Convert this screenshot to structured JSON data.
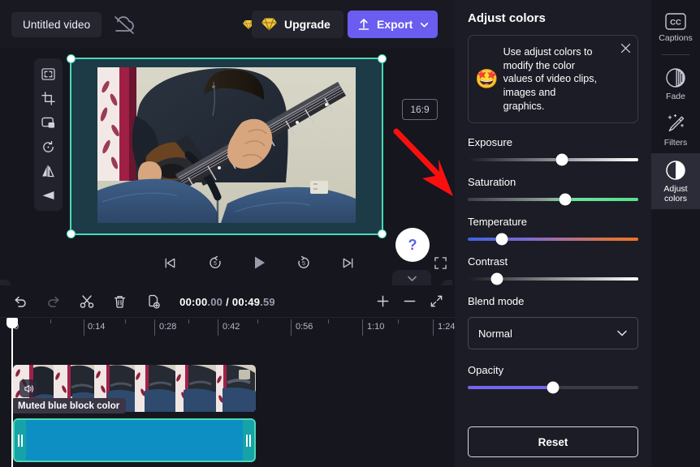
{
  "topbar": {
    "project_title": "Untitled video",
    "cloud_icon": "cloud-off-icon",
    "gem_icon": "gem-icon",
    "upgrade_label": "Upgrade",
    "export_label": "Export",
    "export_caret": "chevron-down-icon"
  },
  "stage": {
    "left_tools": [
      {
        "name": "fit-to-frame-icon",
        "label": "Fit to frame"
      },
      {
        "name": "crop-icon",
        "label": "Crop"
      },
      {
        "name": "picture-in-picture-icon",
        "label": "Picture in picture"
      },
      {
        "name": "rotate-icon",
        "label": "Rotate"
      },
      {
        "name": "flip-horizontal-icon",
        "label": "Flip horizontal"
      },
      {
        "name": "skew-icon",
        "label": "Skew"
      }
    ],
    "aspect_ratio": "16:9",
    "playback": [
      {
        "name": "skip-previous-icon",
        "label": "Previous"
      },
      {
        "name": "rewind-5-icon",
        "label": "Back 5 seconds"
      },
      {
        "name": "play-icon",
        "label": "Play"
      },
      {
        "name": "forward-5-icon",
        "label": "Forward 5 seconds"
      },
      {
        "name": "skip-next-icon",
        "label": "Next"
      }
    ],
    "fullscreen_icon": "fullscreen-icon",
    "help_label": "?",
    "collapse_caret": "chevron-down-icon",
    "panel_toggle_left": "›",
    "panel_toggle_right": "›",
    "annotation_arrow": "red-arrow-annotation"
  },
  "timeline": {
    "tools": [
      {
        "name": "undo-icon",
        "label": "Undo"
      },
      {
        "name": "redo-icon",
        "label": "Redo"
      },
      {
        "name": "split-icon",
        "label": "Split"
      },
      {
        "name": "delete-icon",
        "label": "Delete"
      },
      {
        "name": "duplicate-icon",
        "label": "Duplicate"
      }
    ],
    "current_time": "00:00",
    "current_frames": ".00",
    "separator": "/",
    "total_time": "00:49",
    "total_frames": ".59",
    "zoom_in": "+",
    "zoom_out": "−",
    "fit_icon": "fit-timeline-icon",
    "ruler_ticks": [
      "0",
      "0:14",
      "0:28",
      "0:42",
      "0:56",
      "1:10",
      "1:24"
    ],
    "clip_label": "Muted blue block color",
    "mute_icon": "muted-speaker-icon",
    "color_clip_color": "#0d8fc4",
    "selection_color": "#4ad9b5"
  },
  "panel": {
    "title": "Adjust colors",
    "tip": {
      "emoji": "🤩",
      "text": "Use adjust colors to modify the color values of video clips, images and graphics.",
      "close_icon": "close-icon"
    },
    "controls": [
      {
        "label": "Exposure",
        "value": 52,
        "track": "exposure"
      },
      {
        "label": "Saturation",
        "value": 55,
        "track": "saturation"
      },
      {
        "label": "Temperature",
        "value": 19,
        "track": "temperature"
      },
      {
        "label": "Contrast",
        "value": 16,
        "track": "contrast"
      }
    ],
    "blend_mode_label": "Blend mode",
    "blend_mode_value": "Normal",
    "blend_mode_caret": "chevron-down-icon",
    "opacity_label": "Opacity",
    "opacity_value": 50,
    "reset_label": "Reset"
  },
  "rail": {
    "items": [
      {
        "label": "Captions",
        "icon": "captions-cc-icon",
        "active": false
      },
      {
        "label": "Fade",
        "icon": "fade-icon",
        "active": false
      },
      {
        "label": "Filters",
        "icon": "filters-wand-icon",
        "active": false
      },
      {
        "label": "Adjust colors",
        "icon": "adjust-colors-icon",
        "active": true
      }
    ]
  },
  "colors": {
    "accent": "#6a5df0",
    "selection": "#4ad9b5",
    "upgrade_gold": "#f3c53c",
    "clip_blue": "#0d8fc4",
    "panel_bg": "#1c1c26",
    "app_bg": "#16161f"
  }
}
